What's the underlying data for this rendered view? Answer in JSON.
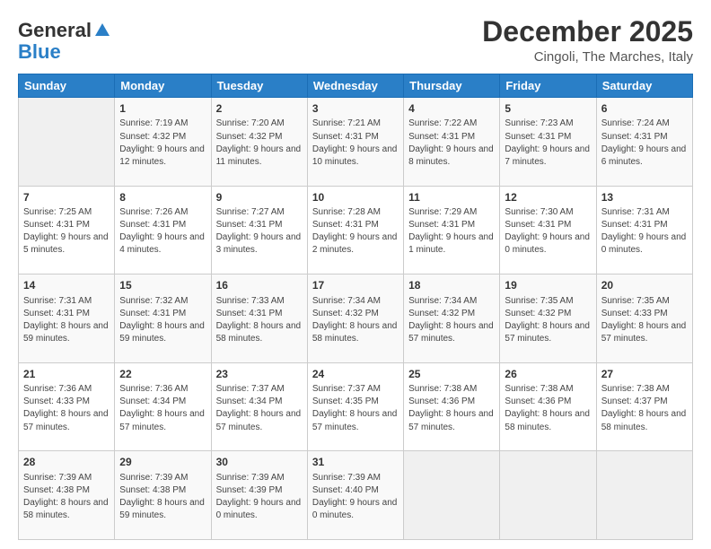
{
  "header": {
    "logo_general": "General",
    "logo_blue": "Blue",
    "month_title": "December 2025",
    "subtitle": "Cingoli, The Marches, Italy"
  },
  "weekdays": [
    "Sunday",
    "Monday",
    "Tuesday",
    "Wednesday",
    "Thursday",
    "Friday",
    "Saturday"
  ],
  "weeks": [
    [
      {
        "day": "",
        "sunrise": "",
        "sunset": "",
        "daylight": ""
      },
      {
        "day": "1",
        "sunrise": "Sunrise: 7:19 AM",
        "sunset": "Sunset: 4:32 PM",
        "daylight": "Daylight: 9 hours and 12 minutes."
      },
      {
        "day": "2",
        "sunrise": "Sunrise: 7:20 AM",
        "sunset": "Sunset: 4:32 PM",
        "daylight": "Daylight: 9 hours and 11 minutes."
      },
      {
        "day": "3",
        "sunrise": "Sunrise: 7:21 AM",
        "sunset": "Sunset: 4:31 PM",
        "daylight": "Daylight: 9 hours and 10 minutes."
      },
      {
        "day": "4",
        "sunrise": "Sunrise: 7:22 AM",
        "sunset": "Sunset: 4:31 PM",
        "daylight": "Daylight: 9 hours and 8 minutes."
      },
      {
        "day": "5",
        "sunrise": "Sunrise: 7:23 AM",
        "sunset": "Sunset: 4:31 PM",
        "daylight": "Daylight: 9 hours and 7 minutes."
      },
      {
        "day": "6",
        "sunrise": "Sunrise: 7:24 AM",
        "sunset": "Sunset: 4:31 PM",
        "daylight": "Daylight: 9 hours and 6 minutes."
      }
    ],
    [
      {
        "day": "7",
        "sunrise": "Sunrise: 7:25 AM",
        "sunset": "Sunset: 4:31 PM",
        "daylight": "Daylight: 9 hours and 5 minutes."
      },
      {
        "day": "8",
        "sunrise": "Sunrise: 7:26 AM",
        "sunset": "Sunset: 4:31 PM",
        "daylight": "Daylight: 9 hours and 4 minutes."
      },
      {
        "day": "9",
        "sunrise": "Sunrise: 7:27 AM",
        "sunset": "Sunset: 4:31 PM",
        "daylight": "Daylight: 9 hours and 3 minutes."
      },
      {
        "day": "10",
        "sunrise": "Sunrise: 7:28 AM",
        "sunset": "Sunset: 4:31 PM",
        "daylight": "Daylight: 9 hours and 2 minutes."
      },
      {
        "day": "11",
        "sunrise": "Sunrise: 7:29 AM",
        "sunset": "Sunset: 4:31 PM",
        "daylight": "Daylight: 9 hours and 1 minute."
      },
      {
        "day": "12",
        "sunrise": "Sunrise: 7:30 AM",
        "sunset": "Sunset: 4:31 PM",
        "daylight": "Daylight: 9 hours and 0 minutes."
      },
      {
        "day": "13",
        "sunrise": "Sunrise: 7:31 AM",
        "sunset": "Sunset: 4:31 PM",
        "daylight": "Daylight: 9 hours and 0 minutes."
      }
    ],
    [
      {
        "day": "14",
        "sunrise": "Sunrise: 7:31 AM",
        "sunset": "Sunset: 4:31 PM",
        "daylight": "Daylight: 8 hours and 59 minutes."
      },
      {
        "day": "15",
        "sunrise": "Sunrise: 7:32 AM",
        "sunset": "Sunset: 4:31 PM",
        "daylight": "Daylight: 8 hours and 59 minutes."
      },
      {
        "day": "16",
        "sunrise": "Sunrise: 7:33 AM",
        "sunset": "Sunset: 4:31 PM",
        "daylight": "Daylight: 8 hours and 58 minutes."
      },
      {
        "day": "17",
        "sunrise": "Sunrise: 7:34 AM",
        "sunset": "Sunset: 4:32 PM",
        "daylight": "Daylight: 8 hours and 58 minutes."
      },
      {
        "day": "18",
        "sunrise": "Sunrise: 7:34 AM",
        "sunset": "Sunset: 4:32 PM",
        "daylight": "Daylight: 8 hours and 57 minutes."
      },
      {
        "day": "19",
        "sunrise": "Sunrise: 7:35 AM",
        "sunset": "Sunset: 4:32 PM",
        "daylight": "Daylight: 8 hours and 57 minutes."
      },
      {
        "day": "20",
        "sunrise": "Sunrise: 7:35 AM",
        "sunset": "Sunset: 4:33 PM",
        "daylight": "Daylight: 8 hours and 57 minutes."
      }
    ],
    [
      {
        "day": "21",
        "sunrise": "Sunrise: 7:36 AM",
        "sunset": "Sunset: 4:33 PM",
        "daylight": "Daylight: 8 hours and 57 minutes."
      },
      {
        "day": "22",
        "sunrise": "Sunrise: 7:36 AM",
        "sunset": "Sunset: 4:34 PM",
        "daylight": "Daylight: 8 hours and 57 minutes."
      },
      {
        "day": "23",
        "sunrise": "Sunrise: 7:37 AM",
        "sunset": "Sunset: 4:34 PM",
        "daylight": "Daylight: 8 hours and 57 minutes."
      },
      {
        "day": "24",
        "sunrise": "Sunrise: 7:37 AM",
        "sunset": "Sunset: 4:35 PM",
        "daylight": "Daylight: 8 hours and 57 minutes."
      },
      {
        "day": "25",
        "sunrise": "Sunrise: 7:38 AM",
        "sunset": "Sunset: 4:36 PM",
        "daylight": "Daylight: 8 hours and 57 minutes."
      },
      {
        "day": "26",
        "sunrise": "Sunrise: 7:38 AM",
        "sunset": "Sunset: 4:36 PM",
        "daylight": "Daylight: 8 hours and 58 minutes."
      },
      {
        "day": "27",
        "sunrise": "Sunrise: 7:38 AM",
        "sunset": "Sunset: 4:37 PM",
        "daylight": "Daylight: 8 hours and 58 minutes."
      }
    ],
    [
      {
        "day": "28",
        "sunrise": "Sunrise: 7:39 AM",
        "sunset": "Sunset: 4:38 PM",
        "daylight": "Daylight: 8 hours and 58 minutes."
      },
      {
        "day": "29",
        "sunrise": "Sunrise: 7:39 AM",
        "sunset": "Sunset: 4:38 PM",
        "daylight": "Daylight: 8 hours and 59 minutes."
      },
      {
        "day": "30",
        "sunrise": "Sunrise: 7:39 AM",
        "sunset": "Sunset: 4:39 PM",
        "daylight": "Daylight: 9 hours and 0 minutes."
      },
      {
        "day": "31",
        "sunrise": "Sunrise: 7:39 AM",
        "sunset": "Sunset: 4:40 PM",
        "daylight": "Daylight: 9 hours and 0 minutes."
      },
      {
        "day": "",
        "sunrise": "",
        "sunset": "",
        "daylight": ""
      },
      {
        "day": "",
        "sunrise": "",
        "sunset": "",
        "daylight": ""
      },
      {
        "day": "",
        "sunrise": "",
        "sunset": "",
        "daylight": ""
      }
    ]
  ]
}
